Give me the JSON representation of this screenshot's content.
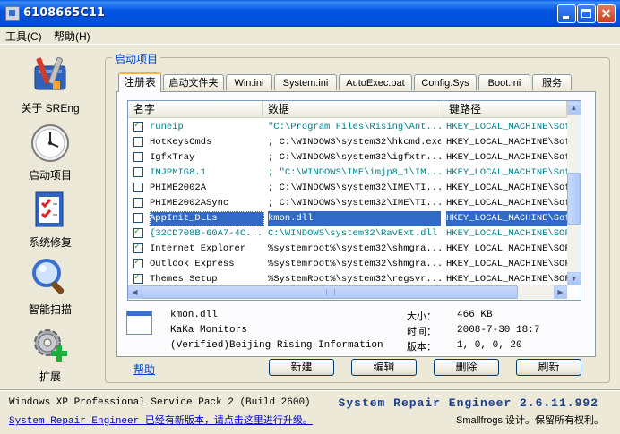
{
  "window": {
    "title": "6108665C11"
  },
  "menu": [
    {
      "label": "工具(C)"
    },
    {
      "label": "帮助(H)"
    }
  ],
  "nav": [
    {
      "label": "关于 SREng",
      "icon": "toolbox-icon"
    },
    {
      "label": "启动项目",
      "icon": "clock-icon"
    },
    {
      "label": "系统修复",
      "icon": "checklist-icon"
    },
    {
      "label": "智能扫描",
      "icon": "magnifier-icon"
    },
    {
      "label": "扩展",
      "icon": "gear-plus-icon"
    }
  ],
  "group": {
    "title": "启动项目"
  },
  "tabs": [
    {
      "label": "注册表"
    },
    {
      "label": "启动文件夹"
    },
    {
      "label": "Win.ini"
    },
    {
      "label": "System.ini"
    },
    {
      "label": "AutoExec.bat"
    },
    {
      "label": "Config.Sys"
    },
    {
      "label": "Boot.ini"
    },
    {
      "label": "服务"
    }
  ],
  "list": {
    "columns": [
      "名字",
      "数据",
      "键路径"
    ],
    "rows": [
      {
        "checked": true,
        "name": "runeip",
        "data": "\"C:\\Program Files\\Rising\\Ant...",
        "path": "HKEY_LOCAL_MACHINE\\Sof",
        "style": "teal"
      },
      {
        "checked": false,
        "name": "HotKeysCmds",
        "data": "; C:\\WINDOWS\\system32\\hkcmd.exe",
        "path": "HKEY_LOCAL_MACHINE\\Sof",
        "style": "normal"
      },
      {
        "checked": false,
        "name": "IgfxTray",
        "data": "; C:\\WINDOWS\\system32\\igfxtr...",
        "path": "HKEY_LOCAL_MACHINE\\Sof",
        "style": "normal"
      },
      {
        "checked": false,
        "name": "IMJPMIG8.1",
        "data": "; \"C:\\WINDOWS\\IME\\imjp8_1\\IM...",
        "path": "HKEY_LOCAL_MACHINE\\Sof",
        "style": "teal"
      },
      {
        "checked": false,
        "name": "PHIME2002A",
        "data": "; C:\\WINDOWS\\system32\\IME\\TI...",
        "path": "HKEY_LOCAL_MACHINE\\Sof",
        "style": "normal"
      },
      {
        "checked": false,
        "name": "PHIME2002ASync",
        "data": "; C:\\WINDOWS\\system32\\IME\\TI...",
        "path": "HKEY_LOCAL_MACHINE\\Sof",
        "style": "normal"
      },
      {
        "checked": false,
        "name": "AppInit_DLLs",
        "data": "kmon.dll",
        "path": "HKEY_LOCAL_MACHINE\\Sof",
        "style": "selected"
      },
      {
        "checked": true,
        "name": "{32CD708B-60A7-4C...",
        "data": "C:\\WINDOWS\\system32\\RavExt.dll",
        "path": "HKEY_LOCAL_MACHINE\\SOF",
        "style": "teal"
      },
      {
        "checked": true,
        "name": "Internet Explorer",
        "data": "%systemroot%\\system32\\shmgra...",
        "path": "HKEY_LOCAL_MACHINE\\SOF",
        "style": "normal"
      },
      {
        "checked": true,
        "name": "Outlook Express",
        "data": "%systemroot%\\system32\\shmgra...",
        "path": "HKEY_LOCAL_MACHINE\\SOF",
        "style": "normal"
      },
      {
        "checked": true,
        "name": "Themes Setup",
        "data": "%SystemRoot%\\system32\\regsvr...",
        "path": "HKEY_LOCAL_MACHINE\\SOF",
        "style": "normal"
      }
    ]
  },
  "details": {
    "filename": "kmon.dll",
    "company": "KaKa Monitors",
    "signature": "(Verified)Beijing Rising Information",
    "size_label": "大小：",
    "size": "466 KB",
    "time_label": "时间：",
    "time": "2008-7-30 18:7",
    "version_label": "版本：",
    "version": "1, 0, 0, 20"
  },
  "buttons": {
    "help": "帮助",
    "new": "新建",
    "edit": "编辑",
    "delete": "删除",
    "refresh": "刷新"
  },
  "status": {
    "os": "Windows XP Professional Service Pack 2 (Build 2600)",
    "update": "System Repair Engineer 已经有新版本，请点击这里进行升级。",
    "product": "System Repair Engineer 2.6.11.992",
    "copyright": "Smallfrogs 设计。保留所有权利。"
  }
}
